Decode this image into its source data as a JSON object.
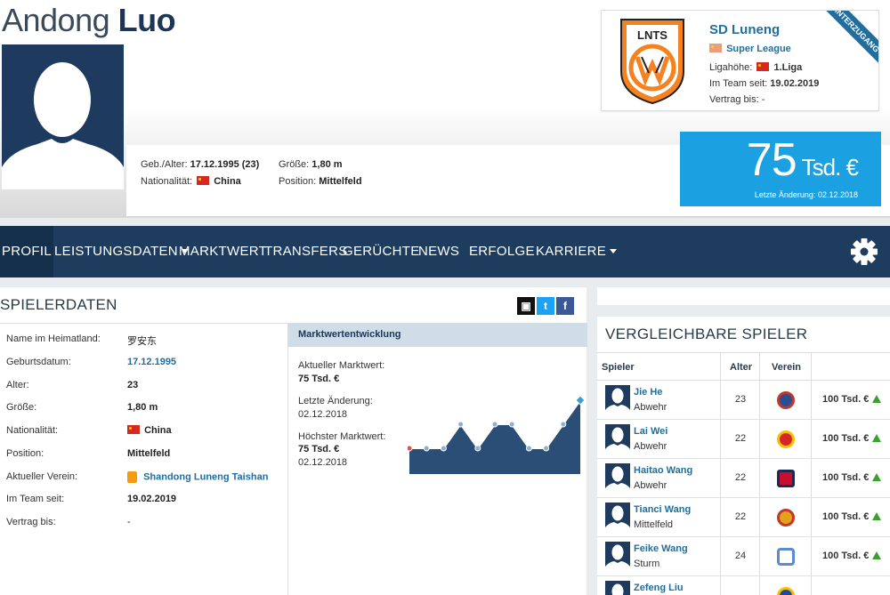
{
  "player": {
    "first_name": "Andong",
    "last_name": "Luo",
    "birth_label": "Geb./Alter:",
    "birth_value": "17.12.1995 (23)",
    "nationality_label": "Nationalität:",
    "nationality_value": "China",
    "height_label": "Größe:",
    "height_value": "1,80 m",
    "position_label": "Position:",
    "position_value": "Mittelfeld"
  },
  "club_box": {
    "name": "SD Luneng",
    "league": "Super League",
    "level_label": "Ligahöhe:",
    "level_value": "1.Liga",
    "since_label": "Im Team seit:",
    "since_value": "19.02.2019",
    "contract_label": "Vertrag bis:",
    "contract_value": "-",
    "ribbon": "WINTERZUGANG",
    "logo_text": "LNTS",
    "logo_ring_text": "SHANDONG LUNENG TAISHAN"
  },
  "market_value_box": {
    "value": "75",
    "unit": "Tsd. €",
    "last_change": "Letzte Änderung: 02.12.2018"
  },
  "nav": {
    "items": [
      {
        "label": "PROFIL"
      },
      {
        "label": "LEISTUNGSDATEN"
      },
      {
        "label": "MARKTWERT"
      },
      {
        "label": "TRANSFERS"
      },
      {
        "label": "GERÜCHTE"
      },
      {
        "label": "NEWS"
      },
      {
        "label": "ERFOLGE"
      },
      {
        "label": "KARRIERE"
      }
    ]
  },
  "player_data": {
    "title": "SPIELERDATEN",
    "rows": [
      {
        "label": "Name im Heimatland:",
        "value": "罗安东"
      },
      {
        "label": "Geburtsdatum:",
        "value": "17.12.1995"
      },
      {
        "label": "Alter:",
        "value": "23"
      },
      {
        "label": "Größe:",
        "value": "1,80 m"
      },
      {
        "label": "Nationalität:",
        "value": "China"
      },
      {
        "label": "Position:",
        "value": "Mittelfeld"
      },
      {
        "label": "Aktueller Verein:",
        "value": "Shandong Luneng Taishan"
      },
      {
        "label": "Im Team seit:",
        "value": "19.02.2019"
      },
      {
        "label": "Vertrag bis:",
        "value": "-"
      }
    ]
  },
  "market_development": {
    "title": "Marktwertentwicklung",
    "current_label": "Aktueller Marktwert:",
    "current_value": "75 Tsd. €",
    "change_label": "Letzte Änderung:",
    "change_value": "02.12.2018",
    "highest_label": "Höchster Marktwert:",
    "highest_value": "75 Tsd. €",
    "highest_date": "02.12.2018"
  },
  "chart_data": {
    "type": "area",
    "title": "",
    "xlabel": "",
    "ylabel": "",
    "values": [
      25,
      25,
      25,
      50,
      25,
      50,
      50,
      25,
      25,
      50,
      75
    ],
    "ylim": [
      0,
      100
    ],
    "grid": false,
    "color": "#2b4e77",
    "line_color": "#ffffff",
    "marker_color": "#8cb1d0",
    "highlight_color": "#3aa0d8"
  },
  "comparable": {
    "title": "VERGLEICHBARE SPIELER",
    "col_player": "Spieler",
    "col_age": "Alter",
    "col_club": "Verein",
    "rows": [
      {
        "name": "Jie He",
        "position": "Abwehr",
        "age": "23",
        "value": "100 Tsd. €",
        "club_color": "#2c4d91"
      },
      {
        "name": "Lai Wei",
        "position": "Abwehr",
        "age": "22",
        "value": "100 Tsd. €",
        "club_color": "#d7262a"
      },
      {
        "name": "Haitao Wang",
        "position": "Abwehr",
        "age": "22",
        "value": "100 Tsd. €",
        "club_color": "#c8102e"
      },
      {
        "name": "Tianci Wang",
        "position": "Mittelfeld",
        "age": "22",
        "value": "100 Tsd. €",
        "club_color": "#e3a21a"
      },
      {
        "name": "Feike Wang",
        "position": "Sturm",
        "age": "24",
        "value": "100 Tsd. €",
        "club_color": "#5b8bd1"
      },
      {
        "name": "Zefeng Liu",
        "position": "",
        "age": "",
        "value": "",
        "club_color": "#1f4aa0"
      }
    ]
  }
}
